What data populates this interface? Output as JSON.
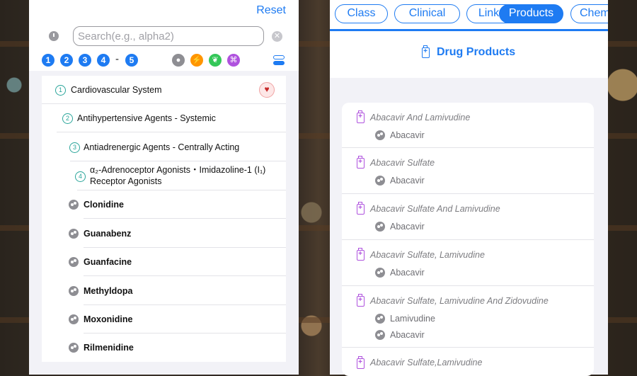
{
  "left": {
    "reset_label": "Reset",
    "search_placeholder": "Search(e.g., alpha2)",
    "levels": [
      "1",
      "2",
      "3",
      "4",
      "-",
      "5"
    ],
    "filters": [
      {
        "icon": "pills-icon",
        "color": "#8e8e93"
      },
      {
        "icon": "bolt-icon",
        "color": "#ff9500"
      },
      {
        "icon": "leaf-icon",
        "color": "#34c759"
      },
      {
        "icon": "command-icon",
        "color": "#af52de"
      }
    ],
    "hierarchy": [
      {
        "level": "1",
        "label": "Cardiovascular System"
      },
      {
        "level": "2",
        "label": "Antihypertensive Agents - Systemic"
      },
      {
        "level": "3",
        "label": "Antiadrenergic Agents - Centrally Acting"
      },
      {
        "level": "4",
        "label": "α₂-Adrenoceptor Agonists・Imidazoline-1 (I₁) Receptor Agonists"
      }
    ],
    "drugs": [
      "Clonidine",
      "Guanabenz",
      "Guanfacine",
      "Methyldopa",
      "Moxonidine",
      "Rilmenidine"
    ]
  },
  "right": {
    "tabs": [
      {
        "label": "Class",
        "active": false
      },
      {
        "label": "Clinical",
        "active": false
      },
      {
        "label": "Links",
        "active": false
      },
      {
        "label": "Products",
        "active": true
      },
      {
        "label": "Chem",
        "active": false
      }
    ],
    "section_title": "Drug Products",
    "products": [
      {
        "name": "Abacavir And Lamivudine",
        "ingredients": [
          "Abacavir"
        ]
      },
      {
        "name": "Abacavir Sulfate",
        "ingredients": [
          "Abacavir"
        ]
      },
      {
        "name": "Abacavir Sulfate And Lamivudine",
        "ingredients": [
          "Abacavir"
        ]
      },
      {
        "name": "Abacavir Sulfate, Lamivudine",
        "ingredients": [
          "Abacavir"
        ]
      },
      {
        "name": "Abacavir Sulfate, Lamivudine And Zidovudine",
        "ingredients": [
          "Lamivudine",
          "Abacavir"
        ]
      },
      {
        "name": "Abacavir Sulfate,Lamivudine",
        "ingredients": []
      }
    ],
    "accent_color": "#1e7bf2",
    "product_icon_color": "#af52de"
  }
}
